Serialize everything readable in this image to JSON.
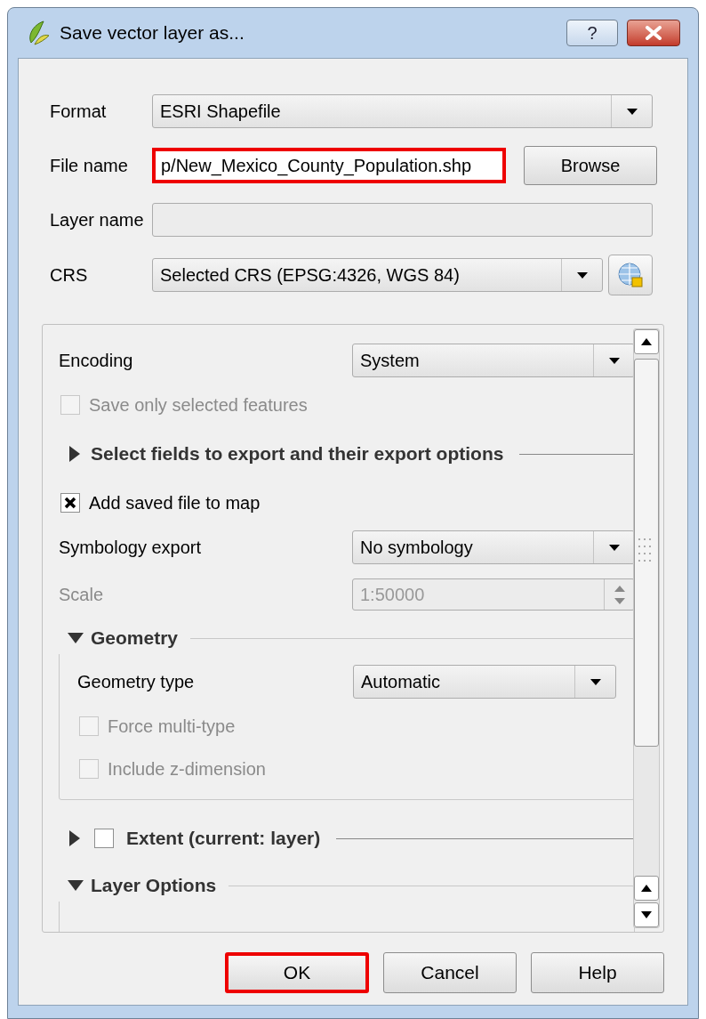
{
  "window": {
    "title": "Save vector layer as...",
    "help_button": "?"
  },
  "form": [
    {
      "kind": "combo",
      "label": "Format",
      "value": "ESRI Shapefile"
    },
    {
      "kind": "file",
      "label": "File name",
      "value": "p/New_Mexico_County_Population.shp",
      "highlighted": true,
      "button": "Browse"
    },
    {
      "kind": "text",
      "label": "Layer name"
    },
    {
      "kind": "crs",
      "label": "CRS",
      "value": "Selected CRS (EPSG:4326, WGS 84)"
    }
  ],
  "panel": [
    {
      "kind": "combo",
      "label": "Encoding",
      "value": "System"
    },
    {
      "kind": "checkbox",
      "label": "Save only selected features",
      "checked": false,
      "disabled": true
    },
    {
      "kind": "section",
      "label": "Select fields to export and their export options",
      "expanded": false
    },
    {
      "kind": "checkbox",
      "label": "Add saved file to map",
      "checked": true,
      "disabled": false
    },
    {
      "kind": "combo",
      "label": "Symbology export",
      "value": "No symbology"
    },
    {
      "kind": "spin",
      "label": "Scale",
      "value": "1:50000",
      "disabled": true
    },
    {
      "kind": "group",
      "label": "Geometry",
      "expanded": true,
      "children": [
        {
          "kind": "combo",
          "label": "Geometry type",
          "value": "Automatic"
        },
        {
          "kind": "checkbox",
          "label": "Force multi-type",
          "checked": false,
          "disabled": true
        },
        {
          "kind": "checkbox",
          "label": "Include z-dimension",
          "checked": false,
          "disabled": true
        }
      ]
    },
    {
      "kind": "checksection",
      "label": "Extent (current: layer)",
      "expanded": false,
      "checked": false
    },
    {
      "kind": "group",
      "label": "Layer Options",
      "expanded": true
    }
  ],
  "buttons": [
    {
      "label": "OK",
      "highlighted": true
    },
    {
      "label": "Cancel",
      "highlighted": false
    },
    {
      "label": "Help",
      "highlighted": false
    }
  ]
}
